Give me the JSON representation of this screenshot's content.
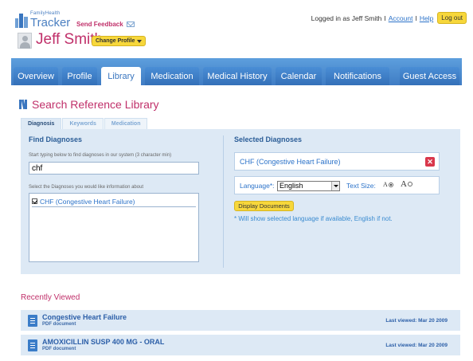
{
  "brand": {
    "line1": "FamilyHealth",
    "line2": "Tracker"
  },
  "header": {
    "feedback_label": "Send Feedback",
    "logged_in_text": "Logged in as Jeff Smith",
    "account_link": "Account",
    "help_link": "Help",
    "separator": "I",
    "logout_label": "Log out",
    "username": "Jeff Smith",
    "change_profile_label": "Change Profile"
  },
  "nav": {
    "tabs": [
      {
        "label": "Overview",
        "active": false
      },
      {
        "label": "Profile",
        "active": false
      },
      {
        "label": "Library",
        "active": true
      },
      {
        "label": "Medication",
        "active": false
      },
      {
        "label": "Medical History",
        "active": false
      },
      {
        "label": "Calendar",
        "active": false
      },
      {
        "label": "Notifications",
        "active": false
      },
      {
        "label": "Guest Access",
        "active": false
      }
    ]
  },
  "library": {
    "title": "Search Reference Library",
    "subtabs": [
      {
        "label": "Diagnosis",
        "active": true
      },
      {
        "label": "Keywords",
        "active": false
      },
      {
        "label": "Medication",
        "active": false
      }
    ],
    "find": {
      "title": "Find Diagnoses",
      "hint": "Start typing below to find diagnoses in our system (3 character min)",
      "search_value": "chf",
      "list_hint": "Select the Diagnoses you would like information about",
      "results": [
        {
          "label": "CHF (Congestive Heart Failure)",
          "checked": true
        }
      ]
    },
    "selected": {
      "title": "Selected Diagnoses",
      "items": [
        {
          "label": "CHF (Congestive Heart Failure)"
        }
      ],
      "language_label": "Language*:",
      "language_value": "English",
      "text_size_label": "Text Size:",
      "text_size_options": [
        {
          "glyph": "A",
          "selected": true
        },
        {
          "glyph": "A",
          "selected": false
        }
      ],
      "display_button": "Display Documents",
      "note": "* Will show selected language if available, English if not."
    }
  },
  "recently_viewed": {
    "title": "Recently Viewed",
    "items": [
      {
        "name": "Congestive Heart Failure",
        "type": "PDF document",
        "last_viewed": "Last viewed: Mar 20 2009"
      },
      {
        "name": "AMOXICILLIN SUSP 400 MG - ORAL",
        "type": "PDF document",
        "last_viewed": "Last viewed: Mar 20 2009"
      }
    ]
  },
  "colors": {
    "brand_pink": "#c0306a",
    "nav_blue": "#4a8ed6",
    "panel_blue": "#dde9f5",
    "button_yellow": "#f7d73b",
    "remove_red": "#d9374b"
  },
  "icons": [
    "family-logo-icon",
    "mail-icon",
    "avatar-icon",
    "dropdown-caret-icon",
    "books-icon",
    "checkbox-icon",
    "remove-icon",
    "radio-icon",
    "pdf-document-icon"
  ]
}
